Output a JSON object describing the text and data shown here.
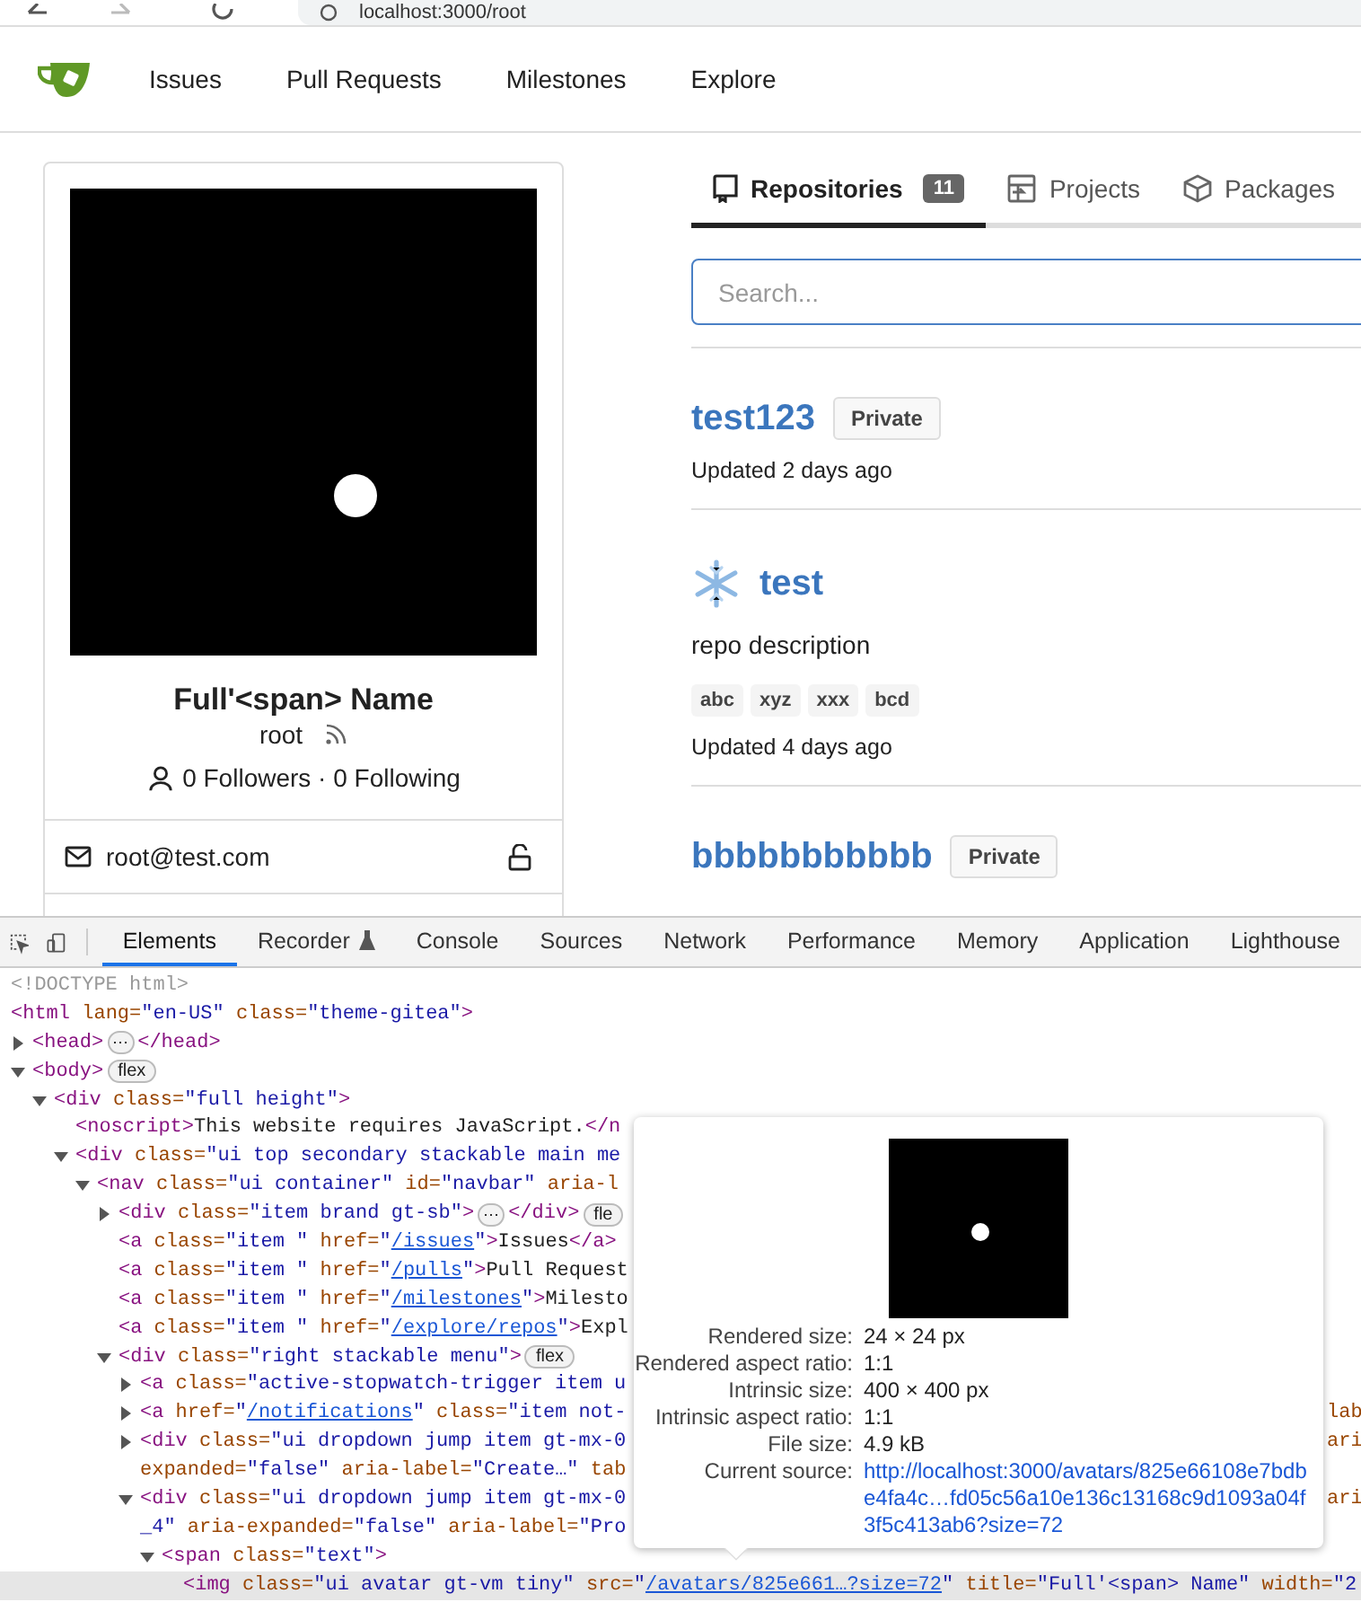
{
  "browser": {
    "address": "localhost:3000/root"
  },
  "navbar": {
    "items": [
      {
        "label": "Issues"
      },
      {
        "label": "Pull Requests"
      },
      {
        "label": "Milestones"
      },
      {
        "label": "Explore"
      }
    ]
  },
  "profile": {
    "full_name": "Full'<span> Name",
    "username": "root",
    "followers": "0 Followers · 0 Following",
    "email": "root@test.com"
  },
  "tabs": [
    {
      "label": "Repositories",
      "count": "11",
      "selected": true
    },
    {
      "label": "Projects",
      "selected": false
    },
    {
      "label": "Packages",
      "selected": false
    }
  ],
  "search": {
    "placeholder": "Search..."
  },
  "repos": [
    {
      "name": "test123",
      "avatar": false,
      "visibility": "Private",
      "updated": "Updated 2 days ago"
    },
    {
      "name": "test",
      "avatar": true,
      "description": "repo description",
      "topics": [
        "abc",
        "xyz",
        "xxx",
        "bcd"
      ],
      "updated": "Updated 4 days ago"
    },
    {
      "name": "bbbbbbbbbbb",
      "avatar": false,
      "visibility": "Private"
    }
  ],
  "devtools": {
    "tabs": [
      {
        "label": "Elements",
        "selected": true
      },
      {
        "label": "Recorder",
        "selected": false
      },
      {
        "label": "Console",
        "selected": false
      },
      {
        "label": "Sources",
        "selected": false
      },
      {
        "label": "Network",
        "selected": false
      },
      {
        "label": "Performance",
        "selected": false
      },
      {
        "label": "Memory",
        "selected": false
      },
      {
        "label": "Application",
        "selected": false
      },
      {
        "label": "Lighthouse",
        "selected": false
      }
    ],
    "dom": [
      {
        "selected": false,
        "segments": [
          {
            "kind": "doctype",
            "text": "<!DOCTYPE html>"
          }
        ]
      },
      {
        "selected": false,
        "segments": [
          {
            "kind": "tag",
            "text": "<html"
          },
          {
            "kind": "attr",
            "text": " lang="
          },
          {
            "kind": "value",
            "text": "\"en-US\""
          },
          {
            "kind": "attr",
            "text": " class="
          },
          {
            "kind": "value",
            "text": "\"theme-gitea\""
          },
          {
            "kind": "tag",
            "text": ">"
          }
        ],
        "children": [
          {
            "expanded": false,
            "selected": false,
            "segments": [
              {
                "kind": "tag",
                "text": "<head>"
              },
              {
                "kind": "ellipsis",
                "text": "⋯"
              },
              {
                "kind": "tag",
                "text": "</head>"
              }
            ]
          },
          {
            "expanded": true,
            "selected": false,
            "segments": [
              {
                "kind": "tag",
                "text": "<body>"
              },
              {
                "kind": "badge",
                "text": "flex"
              }
            ],
            "children": [
              {
                "expanded": true,
                "selected": false,
                "segments": [
                  {
                    "kind": "tag",
                    "text": "<div"
                  },
                  {
                    "kind": "attr",
                    "text": " class="
                  },
                  {
                    "kind": "value",
                    "text": "\"full height\""
                  },
                  {
                    "kind": "tag",
                    "text": ">"
                  }
                ],
                "children": [
                  {
                    "selected": false,
                    "segments": [
                      {
                        "kind": "tag",
                        "text": "<noscript>"
                      },
                      {
                        "kind": "text",
                        "text": "This website requires JavaScript."
                      },
                      {
                        "kind": "tag",
                        "text": "</n"
                      }
                    ]
                  },
                  {
                    "expanded": true,
                    "selected": false,
                    "segments": [
                      {
                        "kind": "tag",
                        "text": "<div"
                      },
                      {
                        "kind": "attr",
                        "text": " class="
                      },
                      {
                        "kind": "value",
                        "text": "\"ui top secondary stackable main me"
                      }
                    ],
                    "children": [
                      {
                        "expanded": true,
                        "selected": false,
                        "segments": [
                          {
                            "kind": "tag",
                            "text": "<nav"
                          },
                          {
                            "kind": "attr",
                            "text": " class="
                          },
                          {
                            "kind": "value",
                            "text": "\"ui container\""
                          },
                          {
                            "kind": "attr",
                            "text": " id="
                          },
                          {
                            "kind": "value",
                            "text": "\"navbar\""
                          },
                          {
                            "kind": "attr",
                            "text": " aria-l"
                          }
                        ],
                        "children": [
                          {
                            "expanded": false,
                            "selected": false,
                            "segments": [
                              {
                                "kind": "tag",
                                "text": "<div"
                              },
                              {
                                "kind": "attr",
                                "text": " class="
                              },
                              {
                                "kind": "value",
                                "text": "\"item brand gt-sb\""
                              },
                              {
                                "kind": "tag",
                                "text": ">"
                              },
                              {
                                "kind": "ellipsis",
                                "text": "⋯"
                              },
                              {
                                "kind": "tag",
                                "text": "</div>"
                              },
                              {
                                "kind": "badge",
                                "text": "fle"
                              }
                            ]
                          },
                          {
                            "selected": false,
                            "segments": [
                              {
                                "kind": "tag",
                                "text": "<a"
                              },
                              {
                                "kind": "attr",
                                "text": " class="
                              },
                              {
                                "kind": "value",
                                "text": "\"item \""
                              },
                              {
                                "kind": "attr",
                                "text": " href="
                              },
                              {
                                "kind": "value",
                                "text": "\""
                              },
                              {
                                "kind": "link",
                                "text": "/issues"
                              },
                              {
                                "kind": "value",
                                "text": "\""
                              },
                              {
                                "kind": "tag",
                                "text": ">"
                              },
                              {
                                "kind": "text",
                                "text": "Issues"
                              },
                              {
                                "kind": "tag",
                                "text": "</a>"
                              }
                            ]
                          },
                          {
                            "selected": false,
                            "segments": [
                              {
                                "kind": "tag",
                                "text": "<a"
                              },
                              {
                                "kind": "attr",
                                "text": " class="
                              },
                              {
                                "kind": "value",
                                "text": "\"item \""
                              },
                              {
                                "kind": "attr",
                                "text": " href="
                              },
                              {
                                "kind": "value",
                                "text": "\""
                              },
                              {
                                "kind": "link",
                                "text": "/pulls"
                              },
                              {
                                "kind": "value",
                                "text": "\""
                              },
                              {
                                "kind": "tag",
                                "text": ">"
                              },
                              {
                                "kind": "text",
                                "text": "Pull Request"
                              }
                            ]
                          },
                          {
                            "selected": false,
                            "segments": [
                              {
                                "kind": "tag",
                                "text": "<a"
                              },
                              {
                                "kind": "attr",
                                "text": " class="
                              },
                              {
                                "kind": "value",
                                "text": "\"item \""
                              },
                              {
                                "kind": "attr",
                                "text": " href="
                              },
                              {
                                "kind": "value",
                                "text": "\""
                              },
                              {
                                "kind": "link",
                                "text": "/milestones"
                              },
                              {
                                "kind": "value",
                                "text": "\""
                              },
                              {
                                "kind": "tag",
                                "text": ">"
                              },
                              {
                                "kind": "text",
                                "text": "Milesto"
                              }
                            ]
                          },
                          {
                            "selected": false,
                            "segments": [
                              {
                                "kind": "tag",
                                "text": "<a"
                              },
                              {
                                "kind": "attr",
                                "text": " class="
                              },
                              {
                                "kind": "value",
                                "text": "\"item \""
                              },
                              {
                                "kind": "attr",
                                "text": " href="
                              },
                              {
                                "kind": "value",
                                "text": "\""
                              },
                              {
                                "kind": "link",
                                "text": "/explore/repos"
                              },
                              {
                                "kind": "value",
                                "text": "\""
                              },
                              {
                                "kind": "tag",
                                "text": ">"
                              },
                              {
                                "kind": "text",
                                "text": "Expl"
                              }
                            ]
                          },
                          {
                            "expanded": true,
                            "selected": false,
                            "segments": [
                              {
                                "kind": "tag",
                                "text": "<div"
                              },
                              {
                                "kind": "attr",
                                "text": " class="
                              },
                              {
                                "kind": "value",
                                "text": "\"right stackable menu\""
                              },
                              {
                                "kind": "tag",
                                "text": ">"
                              },
                              {
                                "kind": "badge",
                                "text": "flex"
                              }
                            ],
                            "children": [
                              {
                                "expanded": false,
                                "selected": false,
                                "segments": [
                                  {
                                    "kind": "tag",
                                    "text": "<a"
                                  },
                                  {
                                    "kind": "attr",
                                    "text": " class="
                                  },
                                  {
                                    "kind": "value",
                                    "text": "\"active-stopwatch-trigger item u"
                                  }
                                ]
                              },
                              {
                                "expanded": false,
                                "selected": false,
                                "tail": "lab",
                                "segments": [
                                  {
                                    "kind": "tag",
                                    "text": "<a"
                                  },
                                  {
                                    "kind": "attr",
                                    "text": " href="
                                  },
                                  {
                                    "kind": "value",
                                    "text": "\""
                                  },
                                  {
                                    "kind": "link",
                                    "text": "/notifications"
                                  },
                                  {
                                    "kind": "value",
                                    "text": "\""
                                  },
                                  {
                                    "kind": "attr",
                                    "text": " class="
                                  },
                                  {
                                    "kind": "value",
                                    "text": "\"item not-"
                                  }
                                ]
                              },
                              {
                                "expanded": false,
                                "selected": false,
                                "tail": "ari",
                                "segments": [
                                  {
                                    "kind": "tag",
                                    "text": "<div"
                                  },
                                  {
                                    "kind": "attr",
                                    "text": " class="
                                  },
                                  {
                                    "kind": "value",
                                    "text": "\"ui dropdown jump item gt-mx-0"
                                  }
                                ],
                                "wrap": [
                                  {
                                    "kind": "attr",
                                    "text": "expanded="
                                  },
                                  {
                                    "kind": "value",
                                    "text": "\"false\""
                                  },
                                  {
                                    "kind": "attr",
                                    "text": " aria-label="
                                  },
                                  {
                                    "kind": "value",
                                    "text": "\"Create…\""
                                  },
                                  {
                                    "kind": "attr",
                                    "text": " tab"
                                  }
                                ]
                              },
                              {
                                "expanded": true,
                                "selected": false,
                                "tail": "ari",
                                "segments": [
                                  {
                                    "kind": "tag",
                                    "text": "<div"
                                  },
                                  {
                                    "kind": "attr",
                                    "text": " class="
                                  },
                                  {
                                    "kind": "value",
                                    "text": "\"ui dropdown jump item gt-mx-0"
                                  }
                                ],
                                "wrap": [
                                  {
                                    "kind": "value",
                                    "text": "_4\""
                                  },
                                  {
                                    "kind": "attr",
                                    "text": " aria-expanded="
                                  },
                                  {
                                    "kind": "value",
                                    "text": "\"false\""
                                  },
                                  {
                                    "kind": "attr",
                                    "text": " aria-label="
                                  },
                                  {
                                    "kind": "value",
                                    "text": "\"Pro"
                                  }
                                ],
                                "children": [
                                  {
                                    "expanded": true,
                                    "selected": false,
                                    "segments": [
                                      {
                                        "kind": "tag",
                                        "text": "<span"
                                      },
                                      {
                                        "kind": "attr",
                                        "text": " class="
                                      },
                                      {
                                        "kind": "value",
                                        "text": "\"text\""
                                      },
                                      {
                                        "kind": "tag",
                                        "text": ">"
                                      }
                                    ],
                                    "children": [
                                      {
                                        "selected": true,
                                        "segments": [
                                          {
                                            "kind": "tag",
                                            "text": "<img"
                                          },
                                          {
                                            "kind": "attr",
                                            "text": " class="
                                          },
                                          {
                                            "kind": "value",
                                            "text": "\"ui avatar gt-vm tiny\""
                                          },
                                          {
                                            "kind": "attr",
                                            "text": " src="
                                          },
                                          {
                                            "kind": "value",
                                            "text": "\""
                                          },
                                          {
                                            "kind": "link",
                                            "text": "/avatars/825e661…?size=72"
                                          },
                                          {
                                            "kind": "value",
                                            "text": "\""
                                          },
                                          {
                                            "kind": "attr",
                                            "text": " title="
                                          },
                                          {
                                            "kind": "value",
                                            "text": "\"Full'<span> Name\""
                                          },
                                          {
                                            "kind": "attr",
                                            "text": " width="
                                          },
                                          {
                                            "kind": "value",
                                            "text": "\"2"
                                          }
                                        ]
                                      }
                                    ]
                                  }
                                ]
                              }
                            ]
                          }
                        ]
                      }
                    ]
                  }
                ]
              }
            ]
          }
        ]
      }
    ],
    "tooltip": {
      "rows": [
        {
          "label": "Rendered size:",
          "value": "24 × 24 px"
        },
        {
          "label": "Rendered aspect ratio:",
          "value": "1:1"
        },
        {
          "label": "Intrinsic size:",
          "value": "400 × 400 px"
        },
        {
          "label": "Intrinsic aspect ratio:",
          "value": "1:1"
        },
        {
          "label": "File size:",
          "value": "4.9 kB"
        }
      ],
      "source_label": "Current source:",
      "source": "http://localhost:3000/avatars/825e66108e7bdbe4fa4c…fd05c56a10e136c13168c9d1093a04f3f5c413ab6?size=72"
    }
  }
}
